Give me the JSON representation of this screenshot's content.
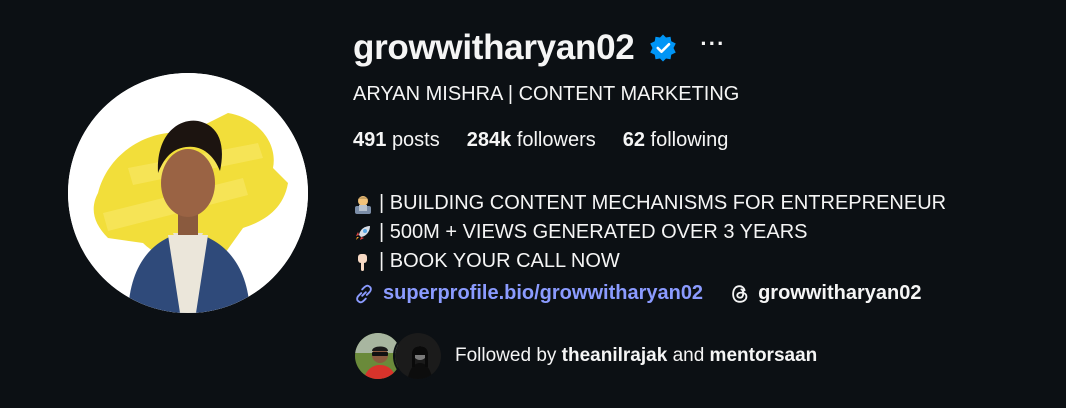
{
  "profile": {
    "username": "growwitharyan02",
    "full_name": "ARYAN MISHRA | CONTENT MARKETING",
    "more_glyph": "···",
    "stats": {
      "posts_count": "491",
      "posts_label": "posts",
      "followers_count": "284k",
      "followers_label": "followers",
      "following_count": "62",
      "following_label": "following"
    },
    "bio": [
      {
        "icon": "technologist-emoji",
        "text": "| BUILDING CONTENT MECHANISMS FOR ENTREPRENEUR"
      },
      {
        "icon": "rocket-emoji",
        "text": "| 500M + VIEWS GENERATED OVER 3 YEARS"
      },
      {
        "icon": "pointing-down-emoji",
        "text": "| BOOK YOUR CALL NOW"
      }
    ],
    "link_text": "superprofile.bio/growwitharyan02",
    "threads_handle": "growwitharyan02",
    "followed_by": {
      "prefix": "Followed by",
      "user1": "theanilrajak",
      "connector": "and",
      "user2": "mentorsaan"
    }
  },
  "colors": {
    "background": "#0c1014",
    "text": "#f5f5f5",
    "link": "#8b9bff",
    "verified": "#0095f6",
    "avatar_highlight": "#f2de3a"
  }
}
